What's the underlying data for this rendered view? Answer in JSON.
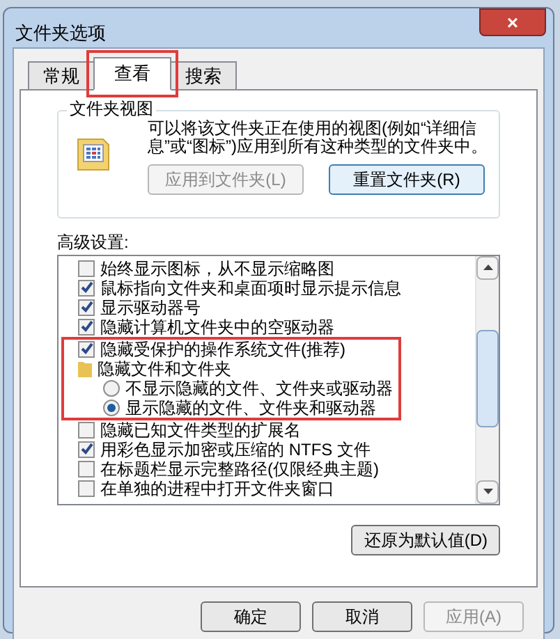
{
  "window": {
    "title": "文件夹选项",
    "close": "×"
  },
  "tabs": [
    {
      "label": "常规",
      "selected": false,
      "highlighted": false
    },
    {
      "label": "查看",
      "selected": true,
      "highlighted": true
    },
    {
      "label": "搜索",
      "selected": false,
      "highlighted": false
    }
  ],
  "folder_views": {
    "title": "文件夹视图",
    "description": "可以将该文件夹正在使用的视图(例如“详细信息”或“图标”)应用到所有这种类型的文件夹中。",
    "buttons": [
      {
        "label": "应用到文件夹(L)",
        "disabled": true
      },
      {
        "label": "重置文件夹(R)",
        "disabled": false
      }
    ]
  },
  "advanced": {
    "title": "高级设置:",
    "items": [
      {
        "kind": "checkbox",
        "label": "始终显示图标，从不显示缩略图",
        "checked": false,
        "highlighted": false
      },
      {
        "kind": "checkbox",
        "label": "鼠标指向文件夹和桌面项时显示提示信息",
        "checked": true,
        "highlighted": false
      },
      {
        "kind": "checkbox",
        "label": "显示驱动器号",
        "checked": true,
        "highlighted": false
      },
      {
        "kind": "checkbox",
        "label": "隐藏计算机文件夹中的空驱动器",
        "checked": true,
        "highlighted": false
      },
      {
        "kind": "checkbox",
        "label": "隐藏受保护的操作系统文件(推荐)",
        "checked": true,
        "highlighted": true
      },
      {
        "kind": "folder",
        "label": "隐藏文件和文件夹",
        "highlighted": true,
        "children": [
          {
            "kind": "radio",
            "label": "不显示隐藏的文件、文件夹或驱动器",
            "selected": false
          },
          {
            "kind": "radio",
            "label": "显示隐藏的文件、文件夹和驱动器",
            "selected": true
          }
        ]
      },
      {
        "kind": "checkbox",
        "label": "隐藏已知文件类型的扩展名",
        "checked": false,
        "highlighted": false
      },
      {
        "kind": "checkbox",
        "label": "用彩色显示加密或压缩的 NTFS 文件",
        "checked": true,
        "highlighted": false
      },
      {
        "kind": "checkbox",
        "label": "在标题栏显示完整路径(仅限经典主题)",
        "checked": false,
        "highlighted": false
      },
      {
        "kind": "checkbox",
        "label": "在单独的进程中打开文件夹窗口",
        "checked": false,
        "highlighted": false
      }
    ],
    "restore_button": "还原为默认值(D)"
  },
  "dialog_buttons": [
    {
      "label": "确定",
      "disabled": false
    },
    {
      "label": "取消",
      "disabled": false
    },
    {
      "label": "应用(A)",
      "disabled": true
    }
  ]
}
